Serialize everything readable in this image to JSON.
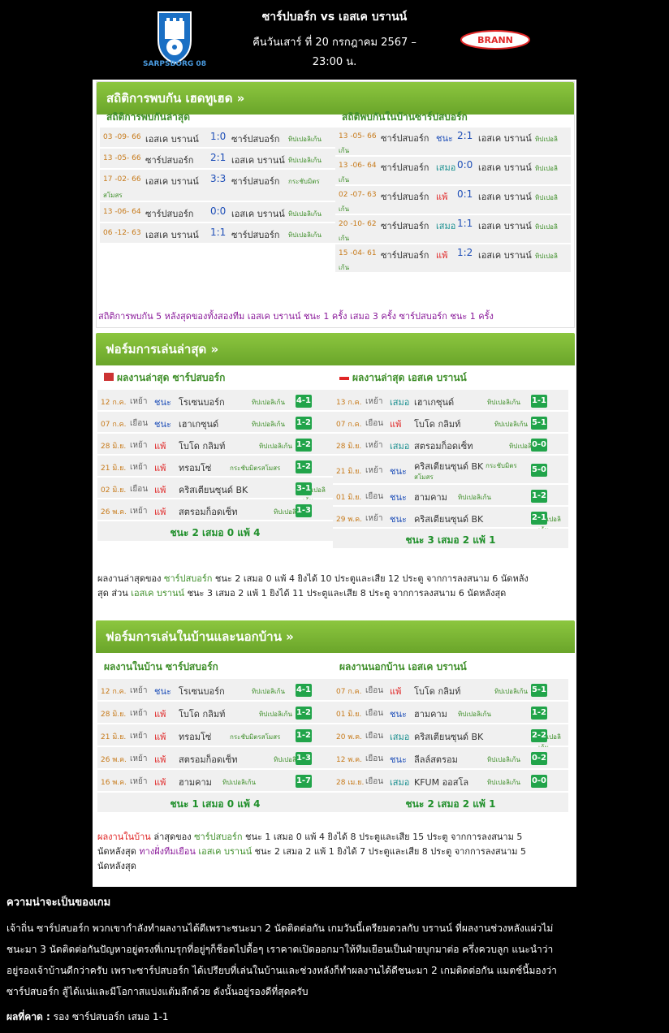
{
  "header": {
    "title": "ซาร์ปบอร์ก vs เอสเค บรานน์",
    "date_line1": "คืนวันเสาร์ ที่ 20 กรกฎาคม 2567 –",
    "date_line2": "23:00 น.",
    "home_logo_text": "SARPSBORG 08",
    "away_logo_text": "BRANN",
    "colors": {
      "home": "#1a6fc4",
      "away": "#e02626"
    }
  },
  "h2h": {
    "title": "สถิติการพบกัน เฮดทูเฮด »",
    "left_title": "สถิติการพบกันล่าสุด",
    "right_title": "สถิติพบกันในบ้านซาร์ปสบอร์ก",
    "left": [
      {
        "date": "03 -09- 66",
        "home": "เอสเค บรานน์",
        "score": "1:0",
        "away": "ซาร์ปสบอร์ก",
        "comp": "ทิปเปอลิเก้น"
      },
      {
        "date": "13 -05- 66",
        "home": "ซาร์ปสบอร์ก",
        "score": "2:1",
        "away": "เอสเค บรานน์",
        "comp": "ทิปเปอลิเก้น"
      },
      {
        "date": "17 -02- 66",
        "home": "เอสเค บรานน์",
        "score": "3:3",
        "away": "ซาร์ปสบอร์ก",
        "comp": "กระชับมิตร",
        "comp2": "สโมสร"
      },
      {
        "date": "13 -06- 64",
        "home": "ซาร์ปสบอร์ก",
        "score": "0:0",
        "away": "เอสเค บรานน์",
        "comp": "ทิปเปอลิเก้น"
      },
      {
        "date": "06 -12- 63",
        "home": "เอสเค บรานน์",
        "score": "1:1",
        "away": "ซาร์ปสบอร์ก",
        "comp": "ทิปเปอลิเก้น"
      }
    ],
    "right": [
      {
        "date": "13 -05- 66",
        "home": "ซาร์ปสบอร์ก",
        "result": "ชนะ",
        "score": "2:1",
        "away": "เอสเค บรานน์",
        "comp": "ทิปเปอลิ",
        "comp2": "เก้น",
        "rtype": "win"
      },
      {
        "date": "13 -06- 64",
        "home": "ซาร์ปสบอร์ก",
        "result": "เสมอ",
        "score": "0:0",
        "away": "เอสเค บรานน์",
        "comp": "ทิปเปอลิ",
        "comp2": "เก้น",
        "rtype": "draw"
      },
      {
        "date": "02 -07- 63",
        "home": "ซาร์ปสบอร์ก",
        "result": "แพ้",
        "score": "0:1",
        "away": "เอสเค บรานน์",
        "comp": "ทิปเปอลิ",
        "comp2": "เก้น",
        "rtype": "loss"
      },
      {
        "date": "20 -10- 62",
        "home": "ซาร์ปสบอร์ก",
        "result": "เสมอ",
        "score": "1:1",
        "away": "เอสเค บรานน์",
        "comp": "ทิปเปอลิ",
        "comp2": "เก้น",
        "rtype": "draw"
      },
      {
        "date": "15 -04- 61",
        "home": "ซาร์ปสบอร์ก",
        "result": "แพ้",
        "score": "1:2",
        "away": "เอสเค บรานน์",
        "comp": "ทิปเปอลิ",
        "comp2": "เก้น",
        "rtype": "loss"
      }
    ],
    "footer": "สถิติการพบกัน 5 หลังสุดของทั้งสองทีม เอสเค บรานน์ ชนะ 1 ครั้ง เสมอ 3 ครั้ง ซาร์ปสบอร์ก ชนะ 1 ครั้ง"
  },
  "form": {
    "title": "ฟอร์มการเล่นล่าสุด »",
    "left_title": "ผลงานล่าสุด ซาร์ปสบอร์ก",
    "right_title": "ผลงานล่าสุด เอสเค บรานน์",
    "left": [
      {
        "date": "12 ก.ค.",
        "ha": "เหย้า",
        "result": "ชนะ",
        "rtype": "win",
        "opp": "โรเซนบอร์ก",
        "comp": "ทิปเปอลิเก้น",
        "score": "4-1"
      },
      {
        "date": "07 ก.ค.",
        "ha": "เยือน",
        "result": "ชนะ",
        "rtype": "win",
        "opp": "เฮาเกซุนด์",
        "comp": "ทิปเปอลิเก้น",
        "score": "1-2"
      },
      {
        "date": "28 มิ.ย.",
        "ha": "เหย้า",
        "result": "แพ้",
        "rtype": "loss",
        "opp": "โบโด กลิมท์",
        "comp": "ทิปเปอลิเก้น",
        "score": "1-2"
      },
      {
        "date": "21 มิ.ย.",
        "ha": "เหย้า",
        "result": "แพ้",
        "rtype": "loss",
        "opp": "ทรอมโซ่",
        "comp": "กระชับมิตรสโมสร",
        "score": "1-2"
      },
      {
        "date": "02 มิ.ย.",
        "ha": "เยือน",
        "result": "แพ้",
        "rtype": "loss",
        "opp": "คริสเตียนซุนด์ BK",
        "comp": "ทิปเปอลิเก้น",
        "score": "3-1"
      },
      {
        "date": "26 พ.ค.",
        "ha": "เหย้า",
        "result": "แพ้",
        "rtype": "loss",
        "opp": "สตรอมก็อดเซ็ท",
        "comp": "ทิปเปอลิเก้น",
        "score": "1-3"
      }
    ],
    "right": [
      {
        "date": "13 ก.ค.",
        "ha": "เหย้า",
        "result": "เสมอ",
        "rtype": "draw",
        "opp": "เฮาเกซุนด์",
        "comp": "ทิปเปอลิเก้น",
        "score": "1-1"
      },
      {
        "date": "07 ก.ค.",
        "ha": "เยือน",
        "result": "แพ้",
        "rtype": "loss",
        "opp": "โบโด กลิมท์",
        "comp": "ทิปเปอลิเก้น",
        "score": "5-1"
      },
      {
        "date": "28 มิ.ย.",
        "ha": "เหย้า",
        "result": "เสมอ",
        "rtype": "draw",
        "opp": "สตรอมก็อดเซ็ท",
        "comp": "ทิปเปอลิเก้น",
        "score": "0-0"
      },
      {
        "date": "21 มิ.ย.",
        "ha": "เหย้า",
        "result": "ชนะ",
        "rtype": "win",
        "opp": "คริสเตียนซุนด์ BK",
        "comp": "กระชับมิตร",
        "comp2": "สโมสร",
        "score": "5-0"
      },
      {
        "date": "01 มิ.ย.",
        "ha": "เยือน",
        "result": "ชนะ",
        "rtype": "win",
        "opp": "ฮามคาม",
        "comp": "ทิปเปอลิเก้น",
        "score": "1-2"
      },
      {
        "date": "29 พ.ค.",
        "ha": "เหย้า",
        "result": "ชนะ",
        "rtype": "win",
        "opp": "คริสเตียนซุนด์ BK",
        "comp": "ทิปเปอลิเก้น",
        "score": "2-1"
      }
    ],
    "left_summary": "ชนะ 2 เสมอ 0 แพ้ 4",
    "right_summary": "ชนะ 3 เสมอ 2 แพ้ 1",
    "note_a": "ผลงานล่าสุดของ ",
    "note_b": "ซาร์ปสบอร์ก",
    "note_c": " ชนะ 2 เสมอ 0 แพ้ 4 ยิงได้ 10 ประตูและเสีย 12 ประตู จากการลงสนาม 6 นัดหลัง",
    "note_d": "สุด ส่วน ",
    "note_e": "เอสเค บรานน์",
    "note_f": " ชนะ 3 เสมอ 2 แพ้ 1 ยิงได้ 11 ประตูและเสีย 8 ประตู จากการลงสนาม 6 นัดหลังสุด"
  },
  "homeaway": {
    "title": "ฟอร์มการเล่นในบ้านและนอกบ้าน »",
    "left_title": "ผลงานในบ้าน ซาร์ปสบอร์ก",
    "right_title": "ผลงานนอกบ้าน เอสเค บรานน์",
    "left": [
      {
        "date": "12 ก.ค.",
        "ha": "เหย้า",
        "result": "ชนะ",
        "rtype": "win",
        "opp": "โรเซนบอร์ก",
        "comp": "ทิปเปอลิเก้น",
        "score": "4-1"
      },
      {
        "date": "28 มิ.ย.",
        "ha": "เหย้า",
        "result": "แพ้",
        "rtype": "loss",
        "opp": "โบโด กลิมท์",
        "comp": "ทิปเปอลิเก้น",
        "score": "1-2"
      },
      {
        "date": "21 มิ.ย.",
        "ha": "เหย้า",
        "result": "แพ้",
        "rtype": "loss",
        "opp": "ทรอมโซ่",
        "comp": "กระชับมิตรสโมสร",
        "score": "1-2"
      },
      {
        "date": "26 พ.ค.",
        "ha": "เหย้า",
        "result": "แพ้",
        "rtype": "loss",
        "opp": "สตรอมก็อดเซ็ท",
        "comp": "ทิปเปอลิเก้น",
        "score": "1-3"
      },
      {
        "date": "16 พ.ค.",
        "ha": "เหย้า",
        "result": "แพ้",
        "rtype": "loss",
        "opp": "ฮามคาม",
        "comp": "ทิปเปอลิเก้น",
        "score": "1-7"
      }
    ],
    "right": [
      {
        "date": "07 ก.ค.",
        "ha": "เยือน",
        "result": "แพ้",
        "rtype": "loss",
        "opp": "โบโด กลิมท์",
        "comp": "ทิปเปอลิเก้น",
        "score": "5-1"
      },
      {
        "date": "01 มิ.ย.",
        "ha": "เยือน",
        "result": "ชนะ",
        "rtype": "win",
        "opp": "ฮามคาม",
        "comp": "ทิปเปอลิเก้น",
        "score": "1-2"
      },
      {
        "date": "20 พ.ค.",
        "ha": "เยือน",
        "result": "เสมอ",
        "rtype": "draw",
        "opp": "คริสเตียนซุนด์ BK",
        "comp": "ทิปเปอลิเก้น",
        "score": "2-2"
      },
      {
        "date": "12 พ.ค.",
        "ha": "เยือน",
        "result": "ชนะ",
        "rtype": "win",
        "opp": "ลีลล์สตรอม",
        "comp": "ทิปเปอลิเก้น",
        "score": "0-2"
      },
      {
        "date": "28 เม.ย.",
        "ha": "เยือน",
        "result": "เสมอ",
        "rtype": "draw",
        "opp": "KFUM ออสโล",
        "comp": "ทิปเปอลิเก้น",
        "score": "0-0"
      }
    ],
    "left_summary": "ชนะ 1 เสมอ 0 แพ้ 4",
    "right_summary": "ชนะ 2 เสมอ 2 แพ้ 1",
    "note_a": "ผลงานในบ้าน",
    "note_b": " ล่าสุดของ ",
    "note_c": "ซาร์ปสบอร์ก",
    "note_d": " ชนะ 1 เสมอ 0 แพ้ 4 ยิงได้ 8 ประตูและเสีย 15 ประตู จากการลงสนาม 5",
    "note_e": "นัดหลังสุด ",
    "note_f": "ทางฝั่งทีมเยือน",
    "note_g": " ",
    "note_h": "เอสเค บรานน์",
    "note_i": " ชนะ 2 เสมอ 2 แพ้ 1 ยิงได้ 7 ประตูและเสีย 8 ประตู จากการลงสนาม 5",
    "note_j": "นัดหลังสุด"
  },
  "analysis": {
    "heading": "ความน่าจะเป็นของเกม",
    "line1": "เจ้าถิ่น ซาร์ปสบอร์ก พวกเขากำลังทำผลงานได้ดีเพราะชนะมา 2 นัดติดต่อกัน เกมวันนี้เตรียมดวลกับ บรานน์ ที่ผลงานช่วงหลังแผ่วไม่",
    "line2": "ชนะมา 3 นัดติดต่อกันปัญหาอยู่ตรงที่เกมรุกที่อยู่ๆก็ช็อตไปดื้อๆ เราคาดเปิดออกมาให้ทีมเยือนเป็นฝ่ายบุกมาต่อ ครึ่งควบลูก แนะนำว่า",
    "line3": "อยู่รองเจ้าบ้านดีกว่าครับ เพราะซาร์ปสบอร์ก ได้เปรียบที่เล่นในบ้านและช่วงหลังก็ทำผลงานได้ดีชนะมา 2 เกมติดต่อกัน แมตช์นี้มองว่า",
    "line4": "ซาร์ปสบอร์ก สู้ได้แน่และมีโอกาสแบ่งแต้มลึกด้วย ดังนั้นอยู่รองดีที่สุดครับ",
    "pred_label": "ผลที่คาด :",
    "pred_value": " รอง ซาร์ปสบอร์ก เสมอ 1-1"
  }
}
